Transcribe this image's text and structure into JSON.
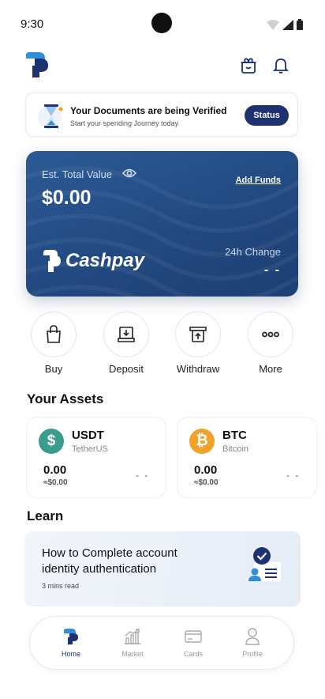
{
  "status_bar": {
    "time": "9:30"
  },
  "verification": {
    "title": "Your Documents are being Verified",
    "subtitle": "Start your spending Journey today",
    "button_label": "Status"
  },
  "balance_card": {
    "label": "Est. Total Value",
    "value": "$0.00",
    "add_funds_label": "Add Funds",
    "brand": "Cashpay",
    "change_label": "24h Change",
    "change_value": "- -"
  },
  "actions": [
    {
      "label": "Buy",
      "icon": "shopping-bag-icon"
    },
    {
      "label": "Deposit",
      "icon": "deposit-icon"
    },
    {
      "label": "Withdraw",
      "icon": "withdraw-icon"
    },
    {
      "label": "More",
      "icon": "more-dots-icon"
    }
  ],
  "assets": {
    "title": "Your Assets",
    "items": [
      {
        "symbol": "USDT",
        "name": "TetherUS",
        "amount": "0.00",
        "usd": "≈$0.00",
        "change": "- -",
        "color": "#3a9c8c",
        "glyph": "$"
      },
      {
        "symbol": "BTC",
        "name": "Bitcoin",
        "amount": "0.00",
        "usd": "≈$0.00",
        "change": "- -",
        "color": "#f2a12b",
        "glyph": "₿"
      }
    ]
  },
  "learn": {
    "title": "Learn",
    "card_title": "How to Complete account identity authentication",
    "read_time": "3 mins read"
  },
  "bottom_nav": [
    {
      "label": "Home",
      "icon": "home-logo-icon",
      "active": true
    },
    {
      "label": "Market",
      "icon": "market-chart-icon",
      "active": false
    },
    {
      "label": "Cards",
      "icon": "card-icon",
      "active": false
    },
    {
      "label": "Profile",
      "icon": "profile-icon",
      "active": false
    }
  ],
  "colors": {
    "primary": "#1e3170",
    "card_blue": "#234b83",
    "accent_blue": "#2f8fd8"
  }
}
